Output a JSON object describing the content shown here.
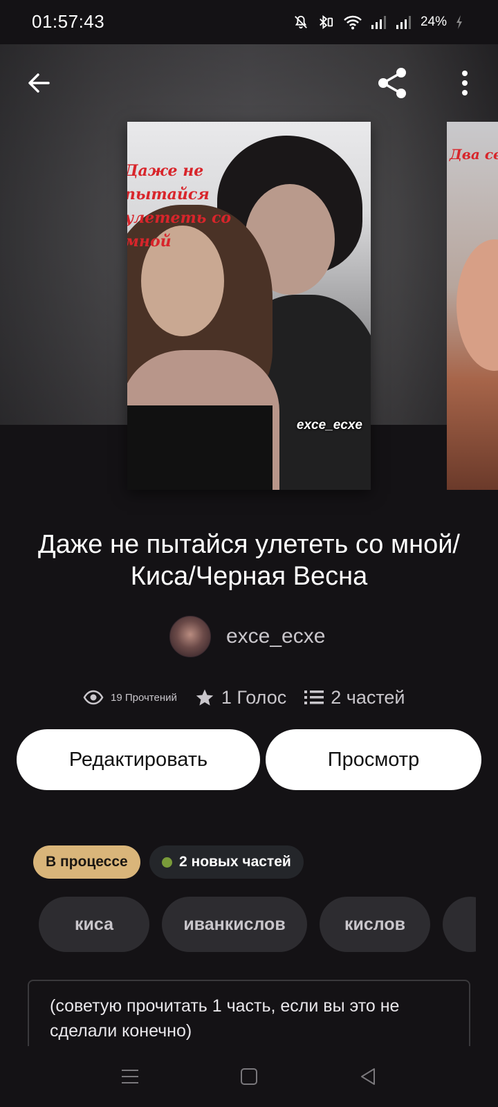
{
  "status_bar": {
    "time": "01:57:43",
    "battery": "24%",
    "icons": [
      "mute-icon",
      "bluetooth-icon",
      "wifi-icon",
      "signal-icon",
      "signal-icon-2",
      "battery-charging-icon"
    ]
  },
  "header": {
    "icons": [
      "back-arrow-icon",
      "share-icon",
      "more-vertical-icon"
    ]
  },
  "cover": {
    "title_text": "Даже не пытайся улететь со мной",
    "watermark": "exce_ecxe"
  },
  "next_cover": {
    "text": "Два сердца т"
  },
  "story": {
    "title": "Даже не пытайся улететь со мной/ Киса/Черная Весна",
    "author": "exce_ecxe",
    "reads": "19 Прочтений",
    "votes": "1 Голос",
    "parts": "2 частей"
  },
  "actions": {
    "edit": "Редактировать",
    "view": "Просмотр"
  },
  "badges": {
    "status": "В процессе",
    "new_parts": "2 новых частей"
  },
  "tags": [
    "киса",
    "иванкислов",
    "кислов",
    ""
  ],
  "description": "(советую прочитать 1 часть, если вы это не сделали конечно)",
  "colors": {
    "background": "#141215",
    "status_badge": "#d9b57a",
    "new_dot": "#7a9b3a",
    "cover_title": "#d8252b"
  }
}
